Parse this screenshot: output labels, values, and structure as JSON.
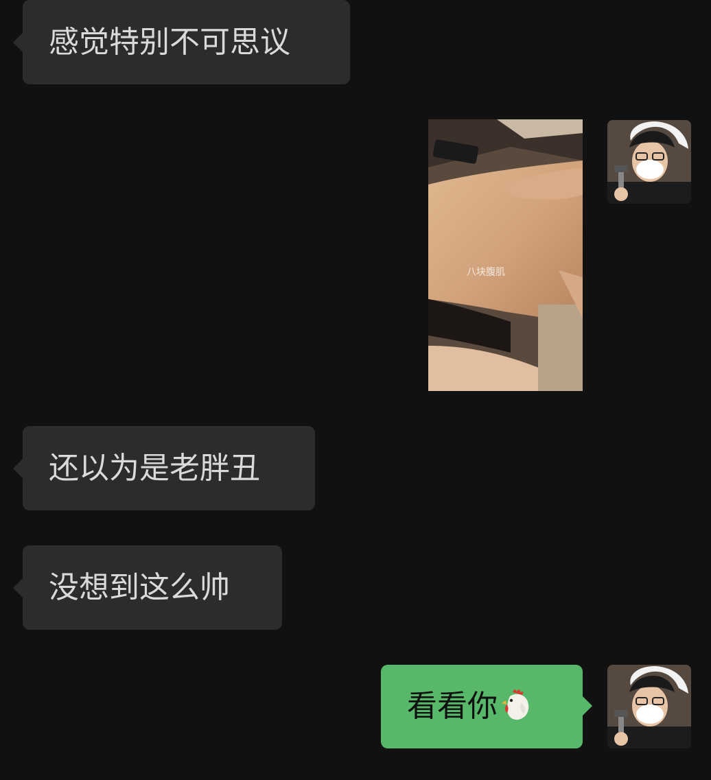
{
  "messages": [
    {
      "direction": "incoming",
      "type": "text",
      "text": "感觉特别不可思议"
    },
    {
      "direction": "outgoing",
      "type": "image",
      "caption": "八块腹肌"
    },
    {
      "direction": "incoming",
      "type": "text",
      "text": "还以为是老胖丑"
    },
    {
      "direction": "incoming",
      "type": "text",
      "text": "没想到这么帅"
    },
    {
      "direction": "outgoing",
      "type": "text",
      "text": "看看你",
      "emoji": "rooster-emoji"
    }
  ],
  "colors": {
    "background": "#111111",
    "incoming_bubble": "#2c2c2c",
    "incoming_text": "#dadada",
    "outgoing_bubble": "#58b86a",
    "outgoing_text": "#101010"
  }
}
